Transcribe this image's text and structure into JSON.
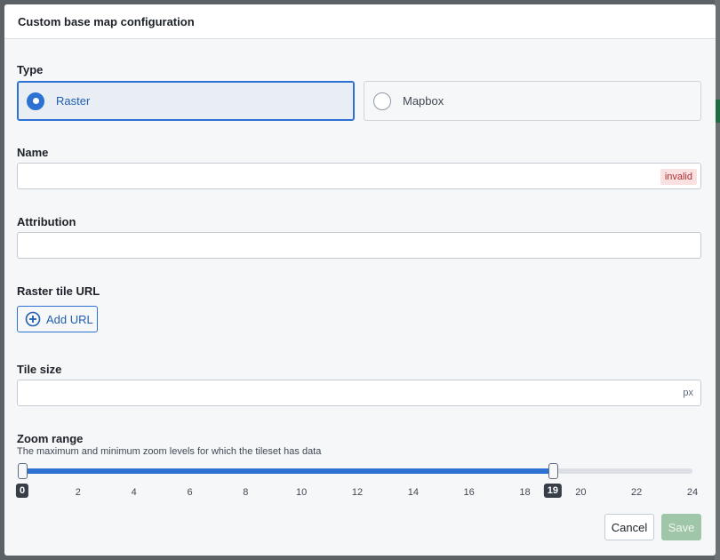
{
  "dialog": {
    "title": "Custom base map configuration"
  },
  "type_section": {
    "label": "Type",
    "options": [
      {
        "label": "Raster",
        "selected": true
      },
      {
        "label": "Mapbox",
        "selected": false
      }
    ]
  },
  "name_section": {
    "label": "Name",
    "value": "",
    "validation_tag": "invalid"
  },
  "attribution_section": {
    "label": "Attribution",
    "value": ""
  },
  "raster_url_section": {
    "label": "Raster tile URL",
    "add_button_label": "Add URL",
    "add_icon": "plus-circle-icon"
  },
  "tile_size_section": {
    "label": "Tile size",
    "value": "",
    "unit": "px"
  },
  "zoom_section": {
    "label": "Zoom range",
    "helper": "The maximum and minimum zoom levels for which the tileset has data",
    "min": 0,
    "max": 24,
    "range_low": 0,
    "range_high": 19,
    "low_label": "0",
    "high_label": "19",
    "ticks": [
      "0",
      "2",
      "4",
      "6",
      "8",
      "10",
      "12",
      "14",
      "16",
      "18",
      "19",
      "20",
      "22",
      "24"
    ]
  },
  "footer": {
    "cancel_label": "Cancel",
    "save_label": "Save"
  },
  "colors": {
    "accent": "#2d72d2",
    "save_disabled": "#9fc6a8",
    "invalid_text": "#ac2f33"
  }
}
